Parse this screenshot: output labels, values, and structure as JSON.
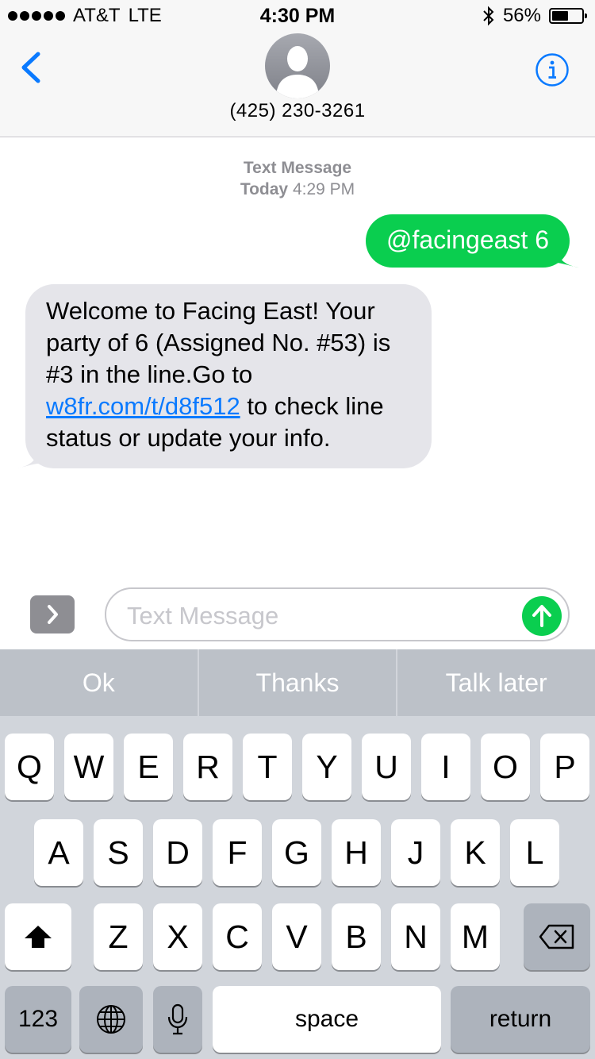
{
  "status_bar": {
    "carrier": "AT&T",
    "network": "LTE",
    "time": "4:30 PM",
    "battery_percent": "56%",
    "battery_level": 0.56,
    "icons": [
      "signal-dots-icon",
      "bluetooth-icon",
      "battery-icon"
    ]
  },
  "header": {
    "back_icon": "chevron-left-icon",
    "avatar_icon": "person-silhouette-icon",
    "contact": "(425) 230-3261",
    "info_icon": "info-icon"
  },
  "conversation": {
    "service": "Text Message",
    "day": "Today",
    "time": "4:29 PM",
    "outgoing": "@facingeast 6",
    "incoming_pre": "Welcome to Facing East! Your party of 6 (Assigned No. #53) is #3 in the line.Go to",
    "incoming_link": "w8fr.com/t/d8f512",
    "incoming_post": "to check line status or update your info."
  },
  "composer": {
    "placeholder": "Text Message",
    "apps_icon": "chevron-right-icon",
    "send_icon": "arrow-up-icon"
  },
  "suggestions": [
    "Ok",
    "Thanks",
    "Talk later"
  ],
  "keyboard": {
    "row1": [
      "Q",
      "W",
      "E",
      "R",
      "T",
      "Y",
      "U",
      "I",
      "O",
      "P"
    ],
    "row2": [
      "A",
      "S",
      "D",
      "F",
      "G",
      "H",
      "J",
      "K",
      "L"
    ],
    "row3": [
      "Z",
      "X",
      "C",
      "V",
      "B",
      "N",
      "M"
    ],
    "numbers": "123",
    "space": "space",
    "return": "return",
    "shift_icon": "shift-arrow-icon",
    "delete_icon": "backspace-icon",
    "globe_icon": "globe-icon",
    "mic_icon": "microphone-icon"
  },
  "colors": {
    "imessage_green": "#0ace4f",
    "link_blue": "#0a7aff",
    "incoming_bubble": "#e5e5ea"
  }
}
